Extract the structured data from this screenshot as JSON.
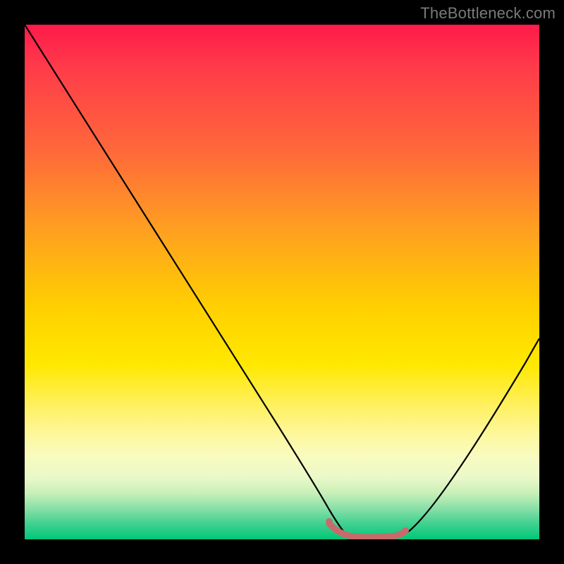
{
  "watermark": "TheBottleneck.com",
  "chart_data": {
    "type": "line",
    "title": "",
    "xlabel": "",
    "ylabel": "",
    "xlim": [
      0,
      100
    ],
    "ylim": [
      0,
      100
    ],
    "grid": false,
    "series": [
      {
        "name": "bottleneck-curve",
        "x": [
          0,
          5,
          10,
          15,
          20,
          25,
          30,
          35,
          40,
          45,
          50,
          55,
          58,
          60,
          62,
          64,
          66,
          68,
          70,
          72,
          75,
          80,
          85,
          90,
          95,
          100
        ],
        "y": [
          100,
          92,
          84,
          76,
          68,
          60,
          52,
          44,
          36,
          28,
          20,
          12,
          6,
          3,
          1,
          0,
          0,
          0,
          0,
          0.5,
          2,
          10,
          20,
          30,
          40,
          50
        ]
      },
      {
        "name": "highlight-segment",
        "x": [
          58,
          60,
          62,
          64,
          66,
          68,
          70,
          72
        ],
        "y": [
          3,
          1.5,
          0.8,
          0.5,
          0.5,
          0.5,
          0.8,
          1.2
        ]
      }
    ],
    "colors": {
      "curve": "#000000",
      "highlight": "#c96a6a",
      "gradient_top": "#ff1a4a",
      "gradient_bottom": "#00c878"
    }
  }
}
